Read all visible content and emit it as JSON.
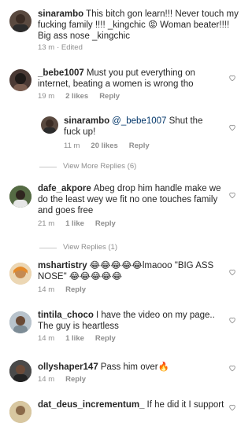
{
  "comments": [
    {
      "user": "sinarambo",
      "text": "This bitch gon learn!!! Never touch my fucking family !!!! _kingchic 😡 Woman beater!!!! Big ass nose _kingchic",
      "time": "13 m",
      "edited": "· Edited"
    },
    {
      "user": "_bebe1007",
      "text": "Must you put everything on internet, beating a women is wrong tho",
      "time": "19 m",
      "likes": "2 likes",
      "reply": "Reply"
    },
    {
      "user": "sinarambo",
      "mention": "@_bebe1007",
      "text": "Shut the fuck up!",
      "time": "11 m",
      "likes": "20 likes",
      "reply": "Reply"
    },
    {
      "user": "dafe_akpore",
      "text": "Abeg drop him handle make we do the least wey we fit no one touches family and goes free",
      "time": "21 m",
      "likes": "1 like",
      "reply": "Reply"
    },
    {
      "user": "mshartistry",
      "text": "😂😂😂😂😂lmaooo \"BIG ASS NOSE\" 😂😂😂😂😂",
      "time": "14 m",
      "reply": "Reply"
    },
    {
      "user": "tintila_choco",
      "text": "I have the video on my page.. The guy is heartless",
      "time": "14 m",
      "likes": "1 like",
      "reply": "Reply"
    },
    {
      "user": "ollyshaper147",
      "text": "Pass him over🔥",
      "time": "14 m",
      "reply": "Reply"
    },
    {
      "user": "dat_deus_incrementum_",
      "text": "If he did it I support"
    }
  ],
  "view_more_replies": "View More Replies (6)",
  "view_replies": "View Replies (1)",
  "colors": {
    "meta": "#8e8e8e",
    "divider": "#c7c7c7",
    "text": "#262626"
  }
}
